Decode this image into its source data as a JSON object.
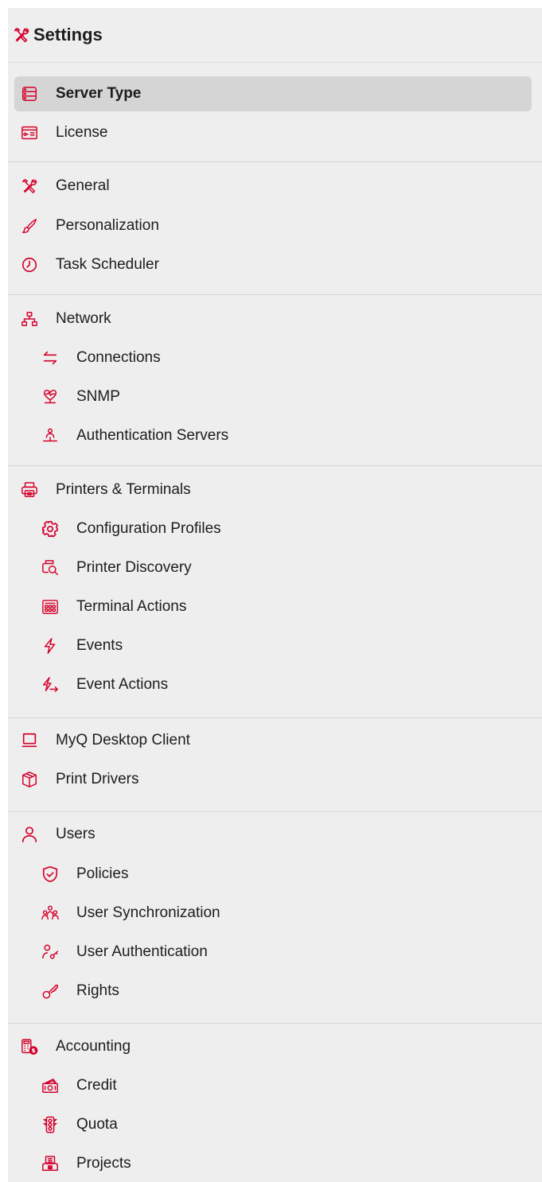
{
  "header": {
    "title": "Settings",
    "icon": "tools-icon"
  },
  "accent_color": "#d5002b",
  "active_item": "Server Type",
  "items": {
    "server_type": "Server Type",
    "license": "License",
    "general": "General",
    "personalization": "Personalization",
    "task_scheduler": "Task Scheduler",
    "network": "Network",
    "connections": "Connections",
    "snmp": "SNMP",
    "authentication_servers": "Authentication Servers",
    "printers_terminals": "Printers & Terminals",
    "configuration_profiles": "Configuration Profiles",
    "printer_discovery": "Printer Discovery",
    "terminal_actions": "Terminal Actions",
    "events": "Events",
    "event_actions": "Event Actions",
    "myq_desktop_client": "MyQ Desktop Client",
    "print_drivers": "Print Drivers",
    "users": "Users",
    "policies": "Policies",
    "user_synchronization": "User Synchronization",
    "user_authentication": "User Authentication",
    "rights": "Rights",
    "accounting": "Accounting",
    "credit": "Credit",
    "quota": "Quota",
    "projects": "Projects"
  }
}
